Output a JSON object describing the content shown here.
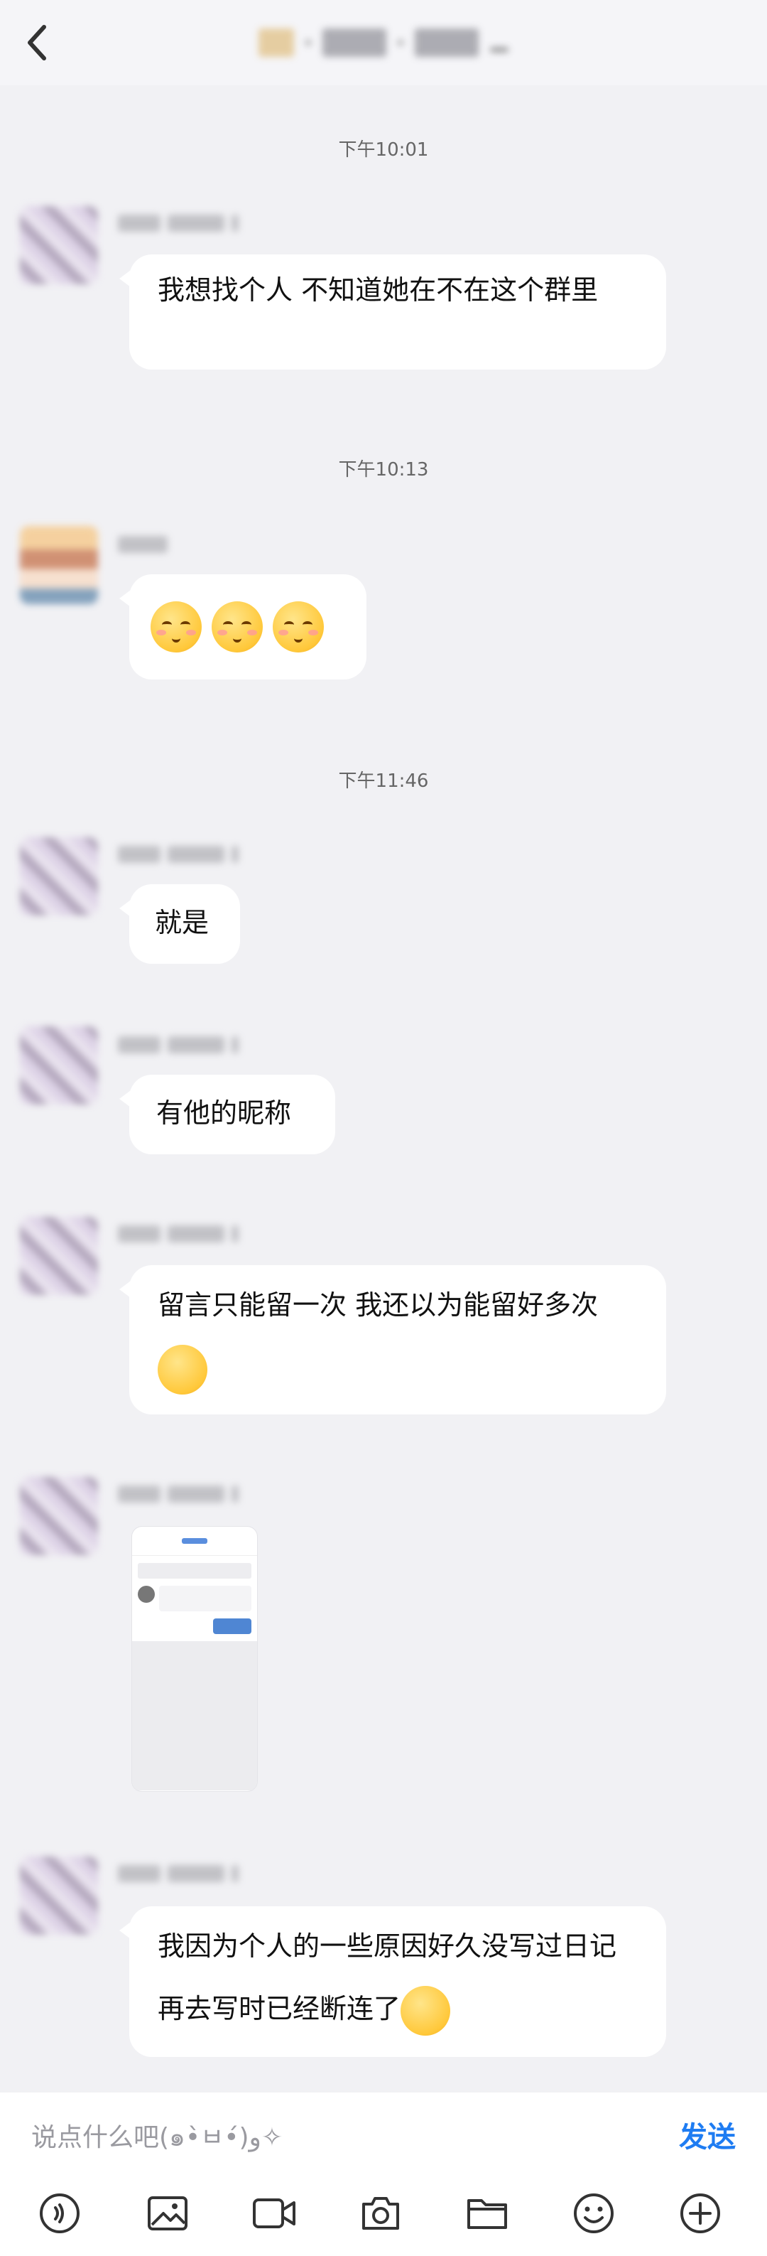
{
  "header": {
    "title": ""
  },
  "messages": [
    {
      "time": "下午10:01",
      "text": "我想找个人 不知道她在不在这个群里"
    },
    {
      "time": "下午10:13",
      "emoji_count": 3
    },
    {
      "time": "下午11:46",
      "text": "就是"
    },
    {
      "text": "有他的昵称"
    },
    {
      "text": "留言只能留一次 我还以为能留好多次"
    },
    {
      "image": true
    },
    {
      "text": "我因为个人的一些原因好久没写过日记 再去写时已经断连了"
    }
  ],
  "input": {
    "placeholder": "说点什么吧(๑•̀ㅂ•́)و✧",
    "send_label": "发送"
  },
  "toolbar": {
    "icons": [
      "voice-icon",
      "image-icon",
      "video-icon",
      "camera-icon",
      "folder-icon",
      "emoji-icon",
      "plus-icon"
    ]
  },
  "colors": {
    "accent": "#1e7cf2",
    "bg": "#f1f1f4",
    "bubble": "#ffffff"
  }
}
